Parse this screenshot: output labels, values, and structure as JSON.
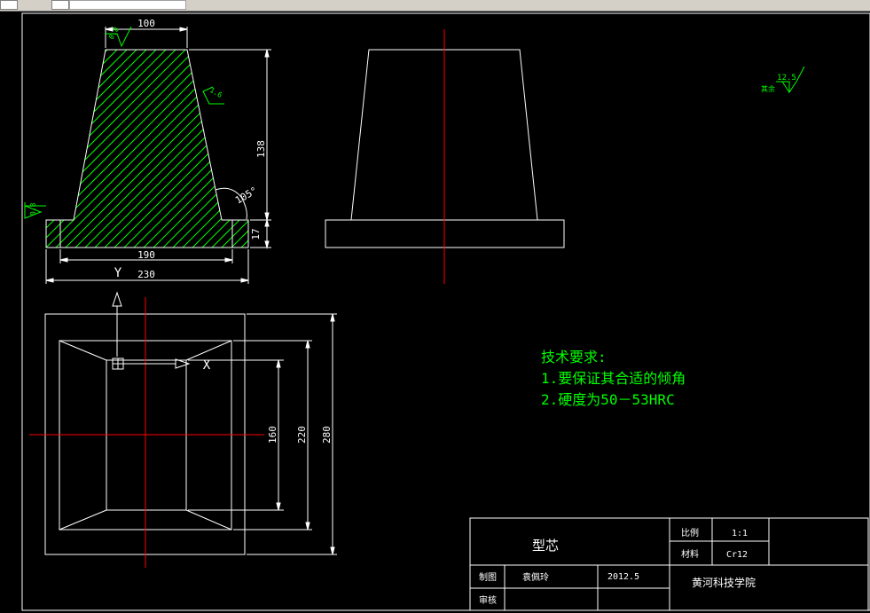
{
  "dims": {
    "top_width": "100",
    "height": "138",
    "base_height": "17",
    "inner_width": "190",
    "total_width": "230",
    "angle": "105°",
    "plan_inner": "160",
    "plan_mid": "220",
    "plan_outer": "280"
  },
  "roughness": {
    "top": "0.8",
    "slope": "1.6",
    "left": "0.8",
    "general_value": "12.5",
    "general_label": "其余"
  },
  "axes": {
    "x": "X",
    "y": "Y"
  },
  "notes": {
    "title": "技术要求:",
    "line1": "1.要保证其合适的倾角",
    "line2": "2.硬度为50－53HRC"
  },
  "title_block": {
    "part_name": "型芯",
    "scale_label": "比例",
    "scale_value": "1:1",
    "material_label": "材料",
    "material_value": "Cr12",
    "drawn_label": "制图",
    "drawn_name": "袁佩玲",
    "date": "2012.5",
    "checked_label": "审核",
    "school": "黄河科技学院"
  },
  "colors": {
    "background": "#000000",
    "line": "#ffffff",
    "hatch": "#00ff00",
    "center": "#ff0000",
    "annotation": "#00ff00"
  }
}
